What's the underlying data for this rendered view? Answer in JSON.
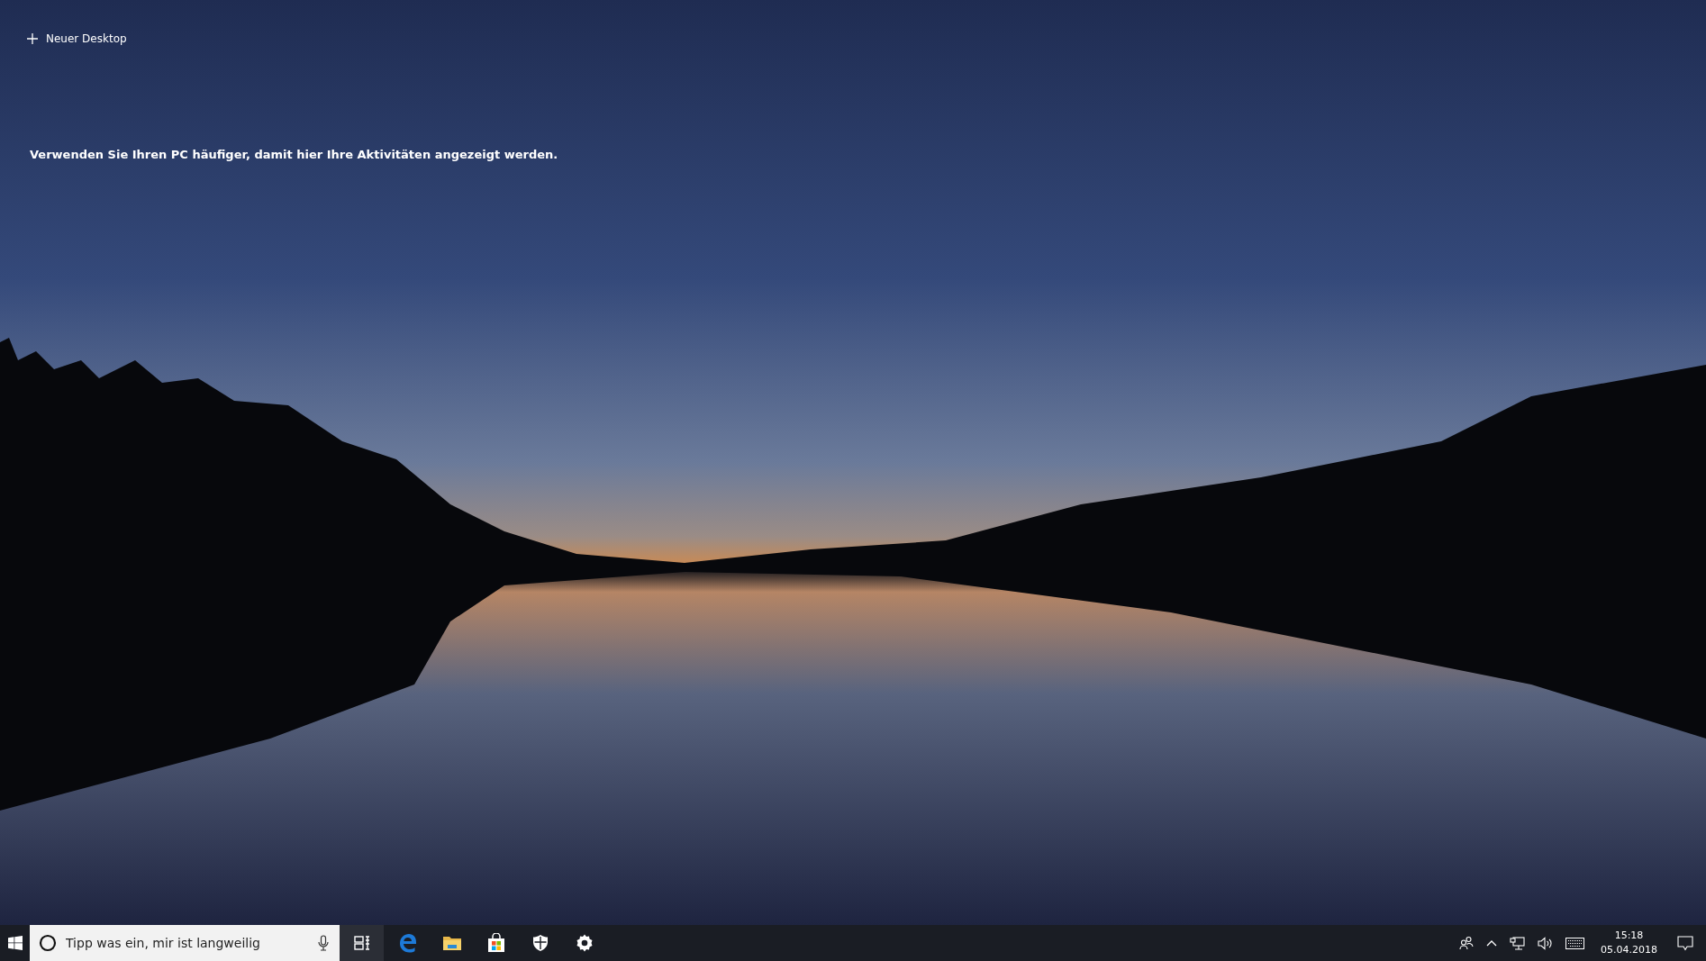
{
  "timeline": {
    "new_desktop": "Neuer Desktop",
    "message": "Verwenden Sie Ihren PC häufiger, damit hier Ihre Aktivitäten angezeigt werden."
  },
  "taskbar": {
    "search": {
      "placeholder": "Tipp was ein, mir ist langweilig"
    },
    "clock": {
      "time": "15:18",
      "date": "05.04.2018"
    }
  }
}
